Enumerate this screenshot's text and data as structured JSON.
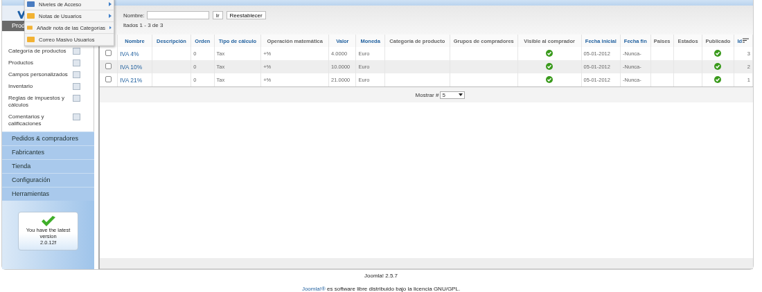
{
  "menu": [
    {
      "label": "Niveles de Acceso",
      "has_submenu": true
    },
    {
      "label": "Notas de Usuarios",
      "has_submenu": true
    },
    {
      "label": "Añadir nota de las Categorías",
      "has_submenu": true
    },
    {
      "label": "Correo Masivo Usuarios",
      "has_submenu": false
    }
  ],
  "sidebar": {
    "tab": {
      "label": "Prod",
      "selected": true
    },
    "items": [
      {
        "label": "Categoría de productos"
      },
      {
        "label": "Productos"
      },
      {
        "label": "Campos personalizados"
      },
      {
        "label": "Inventario"
      },
      {
        "label": "Reglas de impuestos y cálculos"
      },
      {
        "label": "Comentarios y calificaciones"
      }
    ],
    "sections": [
      "Pedidos & compradores",
      "Fabricantes",
      "Tienda",
      "Configuración",
      "Herramientas"
    ],
    "version_box": {
      "message": "You have the latest version",
      "version": "2.0.12f"
    }
  },
  "filter": {
    "label": "Nombre:",
    "go_button": "Ir",
    "reset_button": "Reestablecer",
    "results": "ltados 1 - 3 de 3"
  },
  "table": {
    "columns": [
      {
        "label": "Nombre",
        "sortable": true
      },
      {
        "label": "Descripción",
        "sortable": true
      },
      {
        "label": "Orden",
        "sortable": true
      },
      {
        "label": "Tipo de cálculo",
        "sortable": true
      },
      {
        "label": "Operación matemática",
        "sortable": false
      },
      {
        "label": "Valor",
        "sortable": true
      },
      {
        "label": "Moneda",
        "sortable": true
      },
      {
        "label": "Categoría de producto",
        "sortable": false
      },
      {
        "label": "Grupos de compradores",
        "sortable": false
      },
      {
        "label": "Visible al comprador",
        "sortable": false
      },
      {
        "label": "Fecha inicial",
        "sortable": true
      },
      {
        "label": "Fecha fin",
        "sortable": true
      },
      {
        "label": "Paises",
        "sortable": false
      },
      {
        "label": "Estados",
        "sortable": false
      },
      {
        "label": "Publicado",
        "sortable": false
      },
      {
        "label": "Id",
        "sortable": true
      }
    ],
    "rows": [
      {
        "checked": false,
        "name": "IVA 4%",
        "order": "0",
        "type": "Tax",
        "operation": "+%",
        "value": "4.0000",
        "currency": "Euro",
        "visible": true,
        "start": "05-01-2012",
        "end": "-Nunca-",
        "published": true,
        "id": "3"
      },
      {
        "checked": false,
        "name": "IVA 10%",
        "order": "0",
        "type": "Tax",
        "operation": "+%",
        "value": "10.0000",
        "currency": "Euro",
        "visible": true,
        "start": "05-01-2012",
        "end": "-Nunca-",
        "published": true,
        "id": "2"
      },
      {
        "checked": false,
        "name": "IVA 21%",
        "order": "0",
        "type": "Tax",
        "operation": "+%",
        "value": "21.0000",
        "currency": "Euro",
        "visible": true,
        "start": "05-01-2012",
        "end": "-Nunca-",
        "published": true,
        "id": "1"
      }
    ]
  },
  "pagination": {
    "label": "Mostrar #",
    "value": "5"
  },
  "footer": {
    "version": "Joomla! 2.5.7",
    "license_link": "Joomla!®",
    "license_text": " es software libre distribuido bajo la licencia GNU/GPL."
  }
}
